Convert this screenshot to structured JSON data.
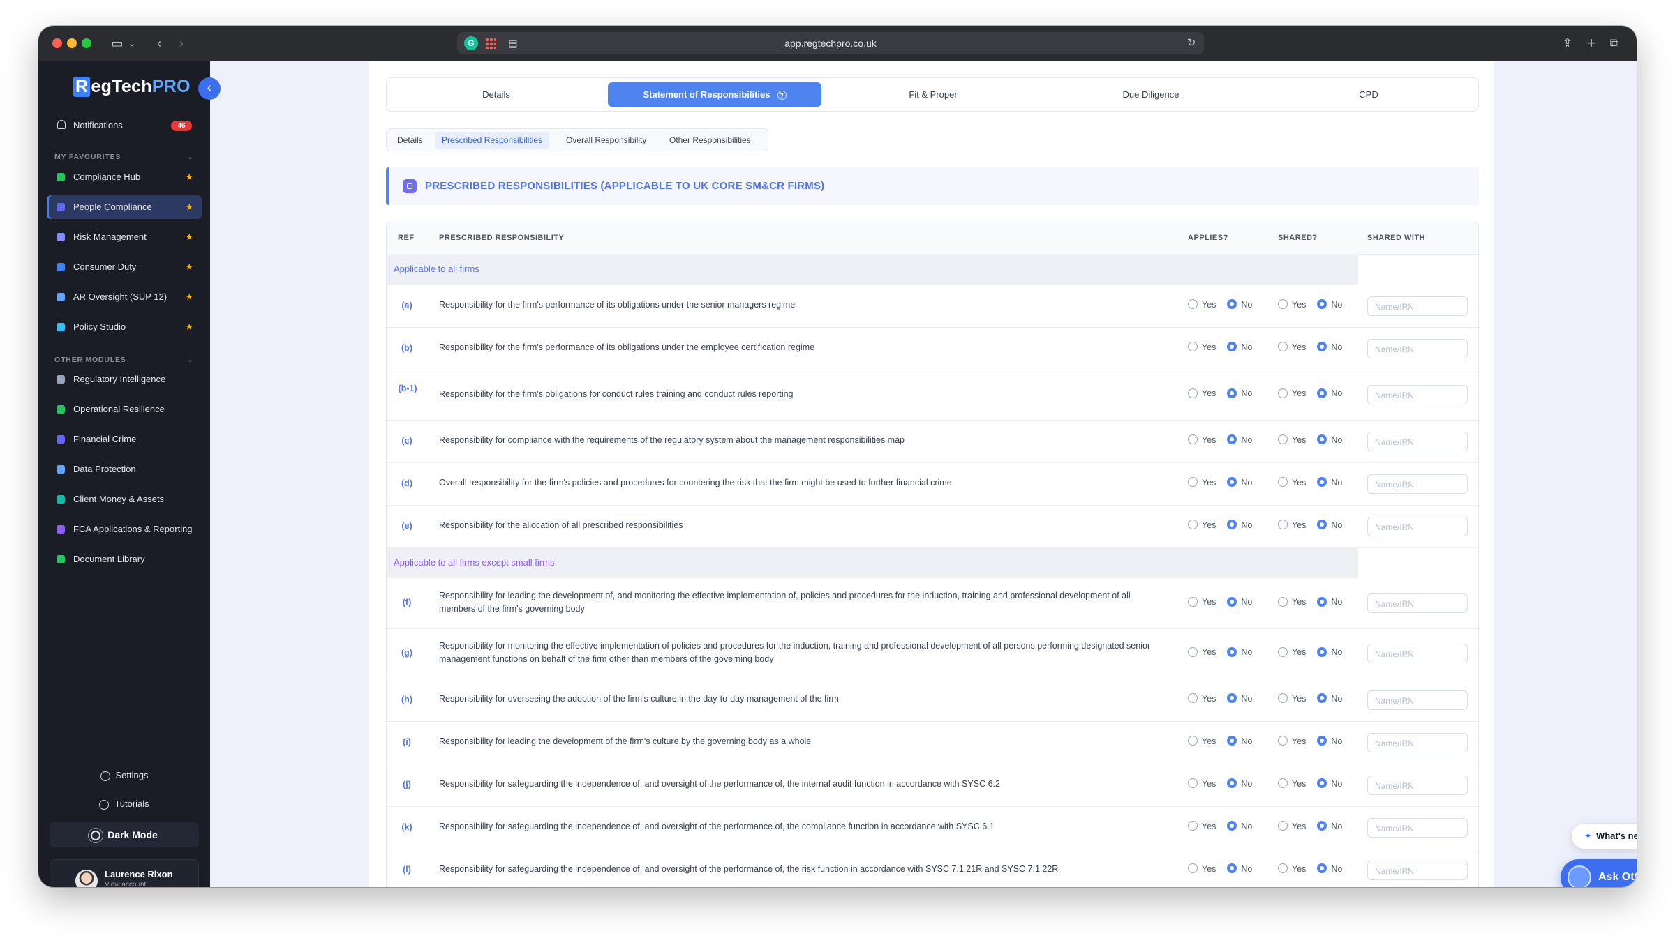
{
  "browser": {
    "url": "app.regtechpro.co.uk"
  },
  "sidebar": {
    "logo_r": "R",
    "logo_main": "egTech",
    "logo_pro": "PRO",
    "notifications": {
      "label": "Notifications",
      "count": "46"
    },
    "favourites_header": "MY FAVOURITES",
    "favourites": [
      {
        "label": "Compliance Hub",
        "color": "#22c55e"
      },
      {
        "label": "People Compliance",
        "color": "#6366f1"
      },
      {
        "label": "Risk Management",
        "color": "#818cf8"
      },
      {
        "label": "Consumer Duty",
        "color": "#3b82f6"
      },
      {
        "label": "AR Oversight (SUP 12)",
        "color": "#60a5fa"
      },
      {
        "label": "Policy Studio",
        "color": "#38bdf8"
      }
    ],
    "other_header": "OTHER MODULES",
    "other": [
      {
        "label": "Regulatory Intelligence",
        "color": "#94a3b8"
      },
      {
        "label": "Operational Resilience",
        "color": "#22c55e"
      },
      {
        "label": "Financial Crime",
        "color": "#6366f1"
      },
      {
        "label": "Data Protection",
        "color": "#60a5fa"
      },
      {
        "label": "Client Money & Assets",
        "color": "#14b8a6"
      },
      {
        "label": "FCA Applications & Reporting",
        "color": "#8b5cf6"
      },
      {
        "label": "Document Library",
        "color": "#22c55e"
      }
    ],
    "settings": "Settings",
    "tutorials": "Tutorials",
    "dark_mode": "Dark Mode",
    "user": {
      "name": "Laurence Rixon",
      "sub": "View account"
    }
  },
  "tabs": [
    "Details",
    "Statement of Responsibilities",
    "Fit & Proper",
    "Due Diligence",
    "CPD"
  ],
  "subtabs": [
    "Details",
    "Prescribed Responsibilities",
    "Overall Responsibility",
    "Other Responsibilities"
  ],
  "banner": "PRESCRIBED RESPONSIBILITIES (APPLICABLE TO UK CORE SM&CR FIRMS)",
  "table": {
    "headers": {
      "ref": "REF",
      "resp": "PRESCRIBED RESPONSIBILITY",
      "applies": "APPLIES?",
      "shared": "SHARED?",
      "shared_with": "SHARED WITH"
    },
    "yes": "Yes",
    "no": "No",
    "placeholder": "Name/IRN",
    "groups": [
      "Applicable to all firms",
      "Applicable to all firms except small firms"
    ],
    "rows": [
      {
        "ref": "(a)",
        "text": "Responsibility for the firm's performance of its obligations under the senior managers regime"
      },
      {
        "ref": "(b)",
        "text": "Responsibility for the firm's performance of its obligations under the employee certification regime"
      },
      {
        "ref": "(b-1)",
        "text": "Responsibility for the firm's obligations for conduct rules training and conduct rules reporting"
      },
      {
        "ref": "(c)",
        "text": "Responsibility for compliance with the requirements of the regulatory system about the management responsibilities map"
      },
      {
        "ref": "(d)",
        "text": "Overall responsibility for the firm's policies and procedures for countering the risk that the firm might be used to further financial crime"
      },
      {
        "ref": "(e)",
        "text": "Responsibility for the allocation of all prescribed responsibilities"
      },
      {
        "ref": "(f)",
        "text": "Responsibility for leading the development of, and monitoring the effective implementation of, policies and procedures for the induction, training and professional development of all members of the firm's governing body"
      },
      {
        "ref": "(g)",
        "text": "Responsibility for monitoring the effective implementation of policies and procedures for the induction, training and professional development of all persons performing designated senior management functions on behalf of the firm other than members of the governing body"
      },
      {
        "ref": "(h)",
        "text": "Responsibility for overseeing the adoption of the firm's culture in the day-to-day management of the firm"
      },
      {
        "ref": "(i)",
        "text": "Responsibility for leading the development of the firm's culture by the governing body as a whole"
      },
      {
        "ref": "(j)",
        "text": "Responsibility for safeguarding the independence of, and oversight of the performance of, the internal audit function in accordance with SYSC 6.2"
      },
      {
        "ref": "(k)",
        "text": "Responsibility for safeguarding the independence of, and oversight of the performance of, the compliance function in accordance with SYSC 6.1"
      },
      {
        "ref": "(l)",
        "text": "Responsibility for safeguarding the independence of, and oversight of the performance of, the risk function in accordance with SYSC 7.1.21R and SYSC 7.1.22R"
      }
    ]
  },
  "floating": {
    "whats_new": "What's new",
    "ask_otto": "Ask Otto"
  }
}
